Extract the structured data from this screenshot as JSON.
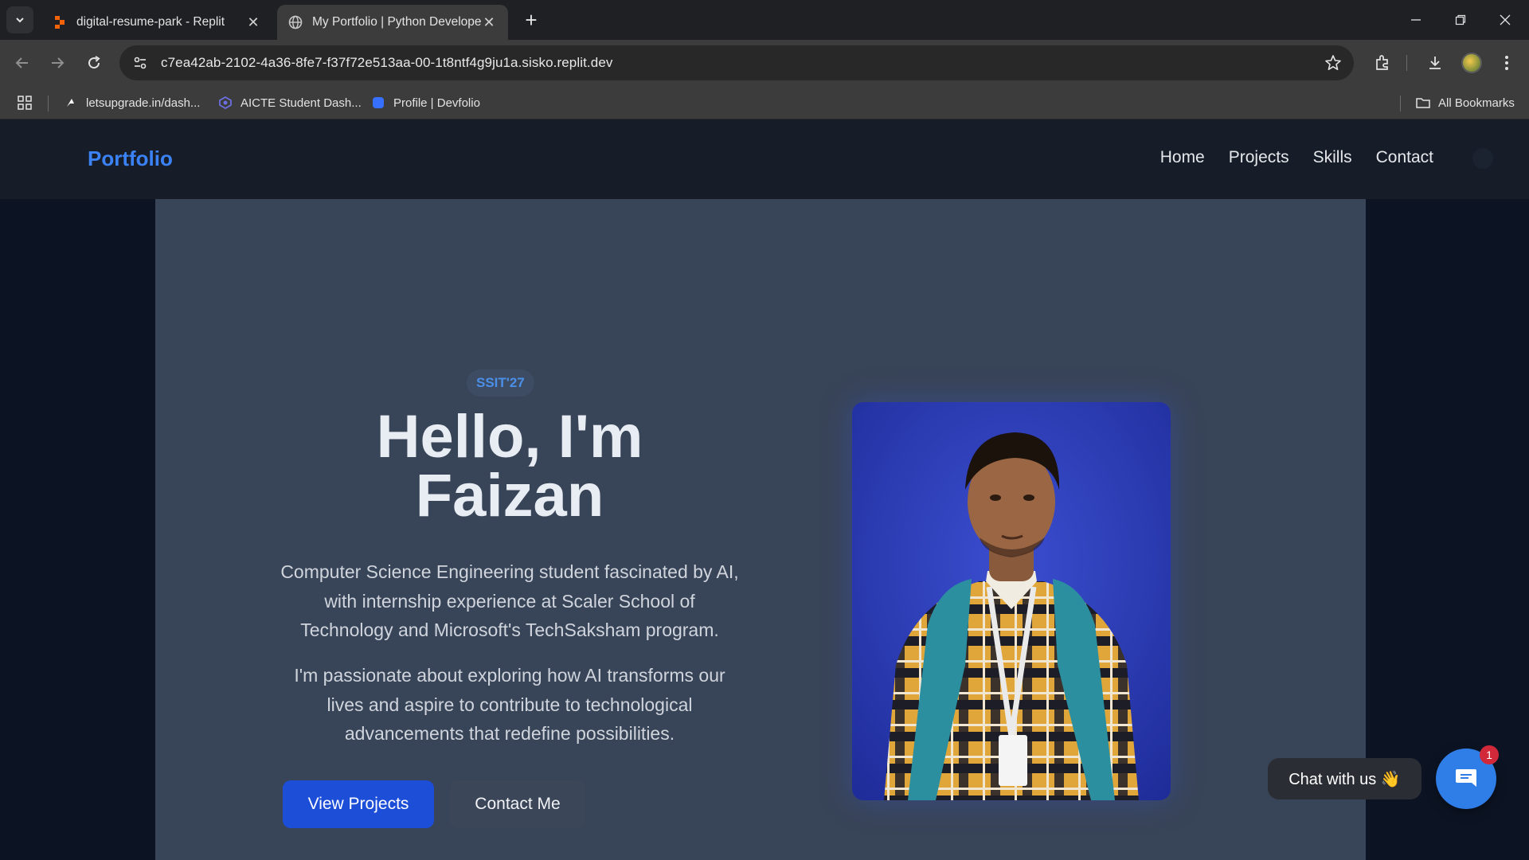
{
  "browser": {
    "tabs": [
      {
        "title": "digital-resume-park - Replit",
        "favicon": "replit-icon",
        "active": false
      },
      {
        "title": "My Portfolio | Python Develope",
        "favicon": "globe-icon",
        "active": true
      }
    ],
    "url": "c7ea42ab-2102-4a36-8fe7-f37f72e513aa-00-1t8ntf4g9ju1a.sisko.replit.dev",
    "bookmarks": [
      {
        "label": "letsupgrade.in/dash...",
        "icon": "letsupgrade-icon"
      },
      {
        "label": "AICTE Student Dash...",
        "icon": "aicte-icon"
      },
      {
        "label": "Profile | Devfolio",
        "icon": "devfolio-icon"
      }
    ],
    "all_bookmarks_label": "All Bookmarks"
  },
  "site": {
    "brand": "Portfolio",
    "nav": [
      "Home",
      "Projects",
      "Skills",
      "Contact"
    ]
  },
  "hero": {
    "badge": "SSIT'27",
    "title_line1": "Hello, I'm",
    "title_line2": "Faizan",
    "paragraph1": "Computer Science Engineering student fascinated by AI, with internship experience at Scaler School of Technology and Microsoft's TechSaksham program.",
    "paragraph2": "I'm passionate about exploring how AI transforms our lives and aspire to contribute to technological advancements that redefine possibilities.",
    "primary_button": "View Projects",
    "secondary_button": "Contact Me"
  },
  "chat": {
    "bubble_text": "Chat with us 👋",
    "badge_count": "1"
  },
  "colors": {
    "brand": "#3b82f6",
    "hero_bg": "#384457",
    "primary_button": "#1d4ed8",
    "chat_launcher": "#2f7de6"
  }
}
